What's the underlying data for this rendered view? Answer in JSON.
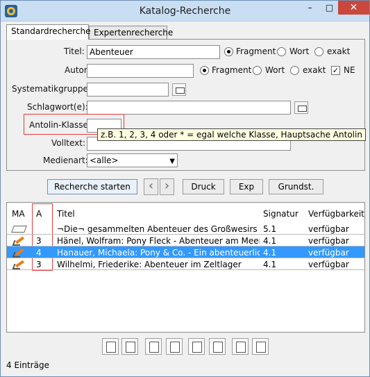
{
  "window": {
    "title": "Katalog-Recherche",
    "controls": [
      "–",
      "□",
      "✕"
    ]
  },
  "tabs": [
    {
      "label": "Standardrecherche"
    },
    {
      "label": "Expertenrecherche"
    }
  ],
  "search": {
    "title_label": "Titel:",
    "title_value": "Abenteuer",
    "author_label": "Autor:",
    "author_value": "",
    "system_group_label": "Systematikgruppe:",
    "system_group_value": "",
    "keyword_label": "Schlagwort(e):",
    "keyword_value": "",
    "antolin_label": "Antolin-Klasse:",
    "antolin_value": "",
    "fulltext_label": "Volltext:",
    "fulltext_value": "",
    "media_label": "Medienart:",
    "media_value": "<alle>",
    "radio_fragment": "Fragment",
    "radio_word": "Wort",
    "radio_exact": "exakt",
    "checkbox_ne": "NE",
    "tooltip": "z.B. 1, 2, 3, 4 oder * = egal welche Klasse, Hauptsache Antolin"
  },
  "buttons": {
    "start": "Recherche starten",
    "print": "Druck",
    "export": "Exp",
    "defaults": "Grundst."
  },
  "table": {
    "columns": [
      "MA",
      "A",
      "Titel",
      "Signatur",
      "Verfügbarkeit"
    ],
    "rows": [
      {
        "ma_icon": "book-icon",
        "a": "",
        "title": "¬Die¬ gesammelten Abenteuer des Großwesirs Isn...",
        "signature": "5.1",
        "availability": "verfügbar"
      },
      {
        "ma_icon": "pen-icon",
        "a": "3",
        "title": "Hänel, Wolfram: Pony Fleck - Abenteuer am Meer",
        "signature": "4.1",
        "availability": "verfügbar"
      },
      {
        "ma_icon": "pen-icon",
        "a": "4",
        "title": "Hanauer, Michaela: Pony & Co. - Ein abenteuerlicher...",
        "signature": "4.1",
        "availability": "verfügbar"
      },
      {
        "ma_icon": "pen-icon",
        "a": "3",
        "title": "Wilhelmi, Friederike: Abenteuer im Zeltlager",
        "signature": "4.1",
        "availability": "verfügbar"
      }
    ]
  },
  "status": {
    "entries": "4 Einträge"
  }
}
